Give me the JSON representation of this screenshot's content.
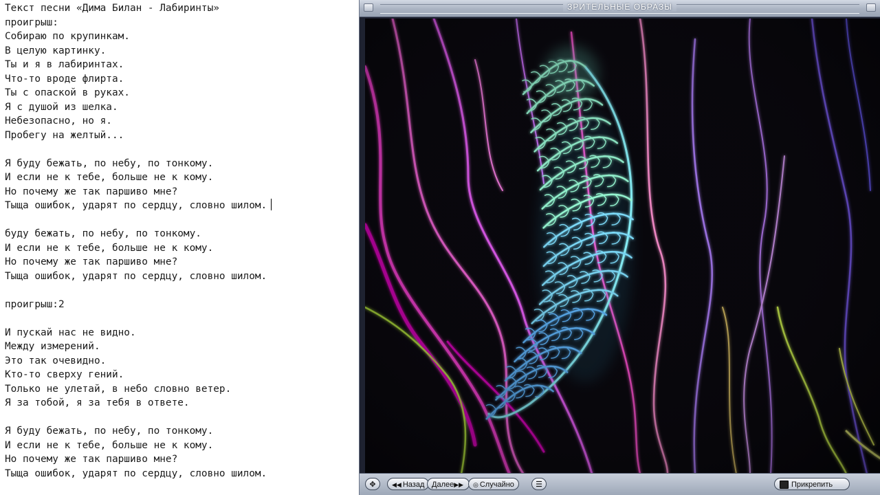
{
  "editor": {
    "lines": [
      "Текст песни «Дима Билан - Лабиринты»",
      "проигрыш:",
      "Собираю по крупинкам.",
      "В целую картинку.",
      "Ты и я в лабиринтах.",
      "Что-то вроде флирта.",
      "Ты с опаской в руках.",
      "Я с душой из шелка.",
      "Небезопасно, но я.",
      "Пробегу на желтый...",
      "",
      "Я буду бежать, по небу, по тонкому.",
      "И если не к тебе, больше не к кому.",
      "Но почему же так паршиво мне?",
      "Тыща ошибок, ударят по сердцу, словно шилом.",
      "",
      "буду бежать, по небу, по тонкому.",
      "И если не к тебе, больше не к кому.",
      "Но почему же так паршиво мне?",
      "Тыща ошибок, ударят по сердцу, словно шилом.",
      "",
      "проигрыш:2",
      "",
      "И пускай нас не видно.",
      "Между измерений.",
      "Это так очевидно.",
      "Кто-то сверху гений.",
      "Только не улетай, в небо словно ветер.",
      "Я за тобой, я за тебя в ответе.",
      "",
      "Я буду бежать, по небу, по тонкому.",
      "И если не к тебе, больше не к кому.",
      "Но почему же так паршиво мне?",
      "Тыща ошибок, ударят по сердцу, словно шилом."
    ]
  },
  "viz": {
    "title": "ЗРИТЕЛЬНЫЕ ОБРАЗЫ",
    "controls": {
      "back": "Назад",
      "next": "Далее",
      "random": "Случайно",
      "attach": "Прикрепить"
    },
    "colors": {
      "pink": "#ff4fd0",
      "magenta": "#e600c8",
      "violet": "#9a7bff",
      "lime": "#c8f060",
      "cyan": "#7ff0ff"
    }
  }
}
